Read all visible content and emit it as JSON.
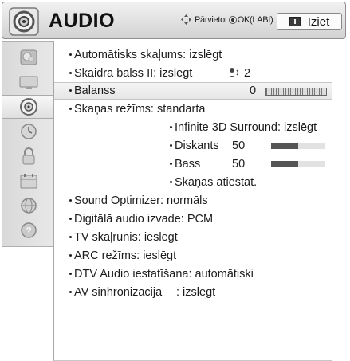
{
  "header": {
    "title": "AUDIO",
    "nav_hint_prefix": "Pārvietot",
    "nav_hint_ok": "OK(LABI)",
    "exit_label": "Iziet"
  },
  "sidebar": {
    "items": [
      {
        "icon": "picture-icon"
      },
      {
        "icon": "screen-icon"
      },
      {
        "icon": "audio-speaker-icon",
        "active": true
      },
      {
        "icon": "clock-icon"
      },
      {
        "icon": "lock-icon"
      },
      {
        "icon": "calendar-icon"
      },
      {
        "icon": "globe-icon"
      },
      {
        "icon": "help-icon"
      }
    ]
  },
  "menu": {
    "auto_volume": "Automātisks skaļums: izslēgt",
    "clear_voice": "Skaidra balss II: izslēgt",
    "clear_voice_value": "2",
    "balance": "Balanss",
    "balance_value": "0",
    "sound_mode": "Skaņas režīms: standarta",
    "surround": "Infinite 3D Surround: izslēgt",
    "treble": "Diskants",
    "treble_value": "50",
    "bass": "Bass",
    "bass_value": "50",
    "sound_reset": "Skaņas atiestat.",
    "sound_optimizer": "Sound Optimizer: normāls",
    "digital_audio_out": "Digitālā audio izvade: PCM",
    "tv_speaker": "TV skaļrunis: ieslēgt",
    "arc_mode": "ARC režīms: ieslēgt",
    "dtv_audio": "DTV Audio iestatīšana: automātiski",
    "av_sync": "AV sinhronizācija",
    "av_sync_value": ": izslēgt"
  },
  "levels": {
    "treble_fill": 0.5,
    "bass_fill": 0.5
  }
}
